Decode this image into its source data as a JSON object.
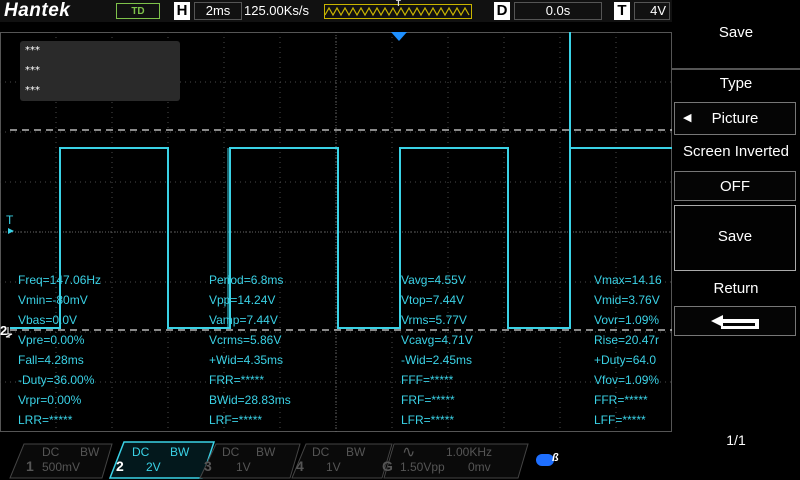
{
  "top": {
    "brand": "Hantek",
    "mode": "TD",
    "h_letter": "H",
    "timebase": "2ms",
    "samplerate": "125.00Ks/s",
    "trig_marker": "T",
    "d_letter": "D",
    "delay": "0.0s",
    "t_letter": "T",
    "trig_level": "4V"
  },
  "annotations": [
    "***",
    "***",
    "***"
  ],
  "markers": {
    "trigger": "T",
    "channel": "2"
  },
  "measurements": {
    "col1": [
      "Freq=147.06Hz",
      "Vmin=-80mV",
      "Vbas=0.0V",
      "Vpre=0.00%",
      "Fall=4.28ms",
      "-Duty=36.00%",
      "Vrpr=0.00%",
      "LRR=*****"
    ],
    "col2": [
      "Period=6.8ms",
      "Vpp=14.24V",
      "Vamp=7.44V",
      "Vcrms=5.86V",
      "+Wid=4.35ms",
      "FRR=*****",
      "BWid=28.83ms",
      "LRF=*****"
    ],
    "col3": [
      "Vavg=4.55V",
      "Vtop=7.44V",
      "Vrms=5.77V",
      "Vcavg=4.71V",
      "-Wid=2.45ms",
      "FFF=*****",
      "FRF=*****",
      "LFR=*****"
    ],
    "col4": [
      "Vmax=14.16",
      "Vmid=3.76V",
      "Vovr=1.09%",
      "Rise=20.47r",
      "+Duty=64.0",
      "Vfov=1.09%",
      "FFR=*****",
      "LFF=*****"
    ]
  },
  "channels": [
    {
      "num": "1",
      "coupling": "DC",
      "bw": "BW",
      "scale": "500mV"
    },
    {
      "num": "2",
      "coupling": "DC",
      "bw": "BW",
      "scale": "2V"
    },
    {
      "num": "3",
      "coupling": "DC",
      "bw": "BW",
      "scale": "1V"
    },
    {
      "num": "4",
      "coupling": "DC",
      "bw": "BW",
      "scale": "1V"
    },
    {
      "num": "G",
      "wave": "∿",
      "freq": "1.00KHz",
      "vpp": "1.50Vpp",
      "offset": "0mv"
    }
  ],
  "menu": {
    "title": "Save",
    "type_label": "Type",
    "type_value": "Picture",
    "inverted_label": "Screen Inverted",
    "inverted_value": "OFF",
    "save_button": "Save",
    "return_label": "Return",
    "page": "1/1"
  },
  "colors": {
    "trace": "#3ad2e6",
    "accent": "#7ec24a",
    "trig": "#1e90ff"
  }
}
